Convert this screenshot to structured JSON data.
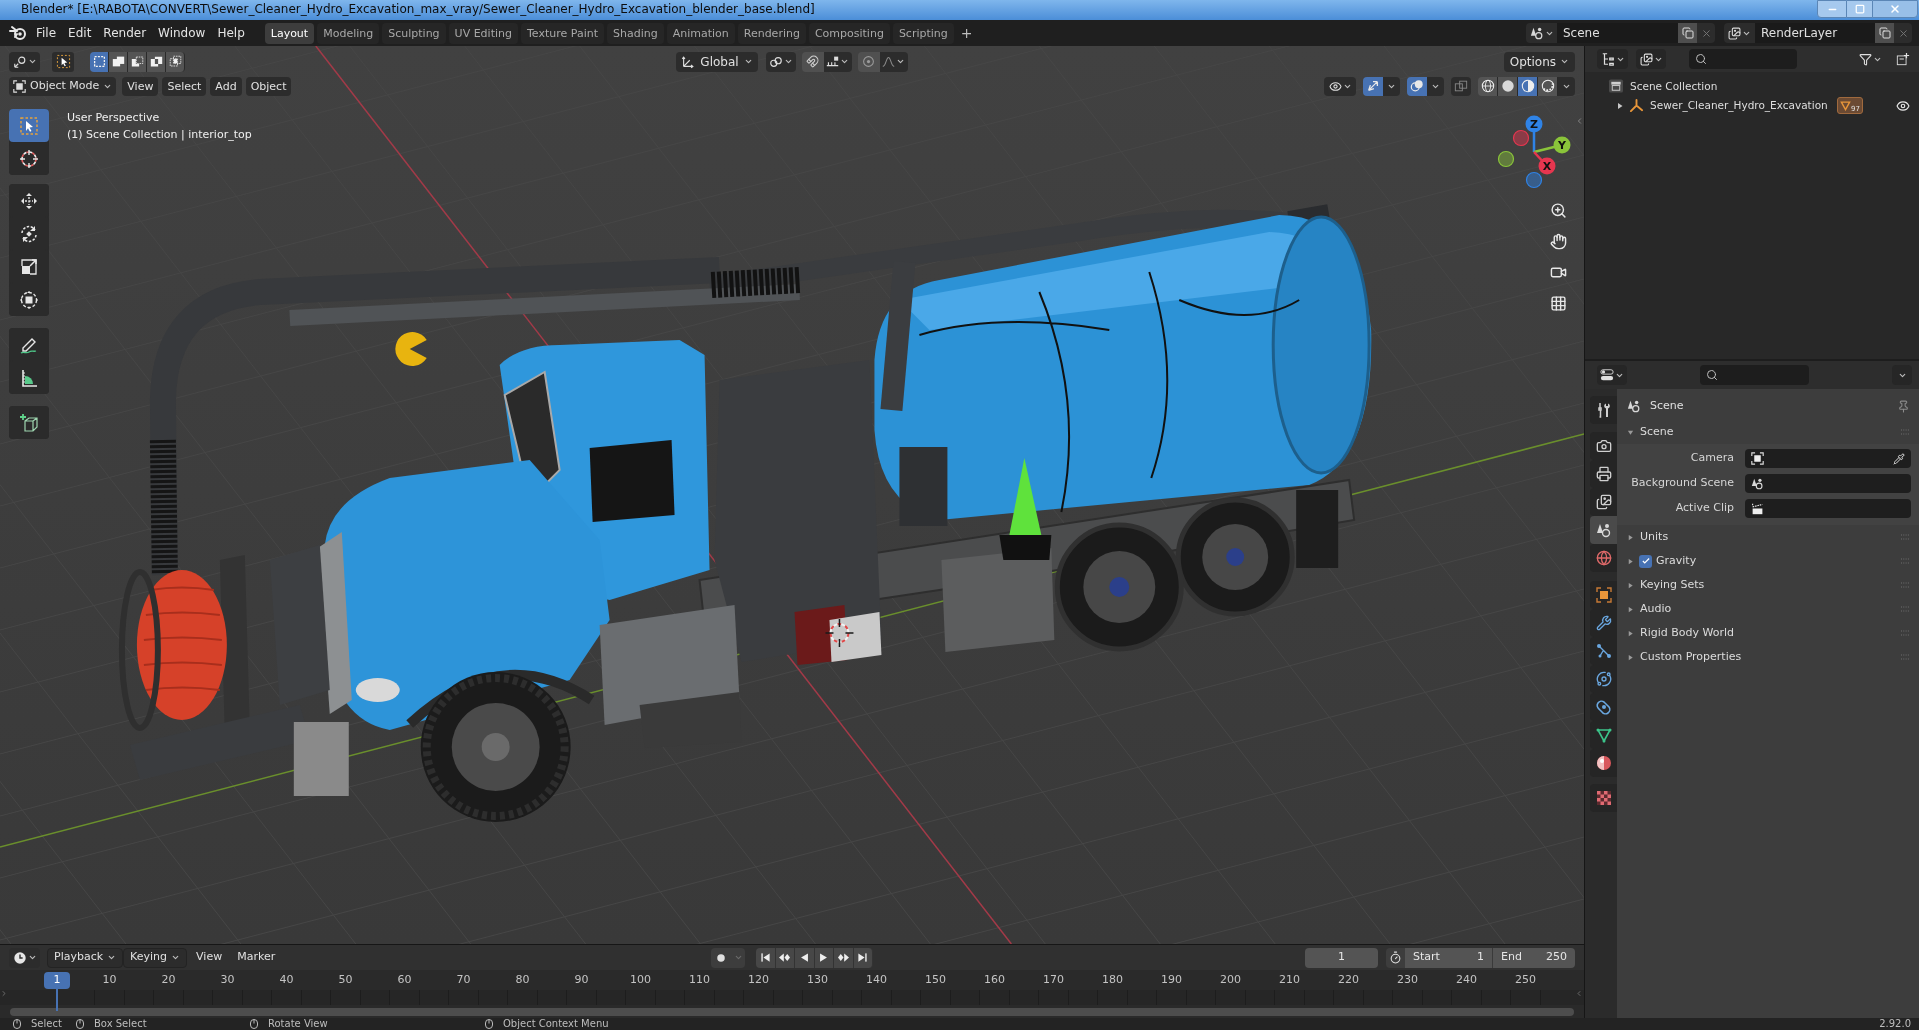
{
  "window": {
    "title": "Blender* [E:\\RABOTA\\CONVERT\\Sewer_Cleaner_Hydro_Excavation_max_vray/Sewer_Cleaner_Hydro_Excavation_blender_base.blend]"
  },
  "top_bar": {
    "menus": [
      "File",
      "Edit",
      "Render",
      "Window",
      "Help"
    ],
    "workspaces": [
      {
        "label": "Layout",
        "selected": true
      },
      {
        "label": "Modeling",
        "selected": false
      },
      {
        "label": "Sculpting",
        "selected": false
      },
      {
        "label": "UV Editing",
        "selected": false
      },
      {
        "label": "Texture Paint",
        "selected": false
      },
      {
        "label": "Shading",
        "selected": false
      },
      {
        "label": "Animation",
        "selected": false
      },
      {
        "label": "Rendering",
        "selected": false
      },
      {
        "label": "Compositing",
        "selected": false
      },
      {
        "label": "Scripting",
        "selected": false
      }
    ],
    "add_workspace": "+",
    "scene": "Scene",
    "view_layer": "RenderLayer"
  },
  "viewport": {
    "tool_header": {
      "selection_modes": [
        {
          "kind": "set",
          "selected": true
        },
        {
          "kind": "extend",
          "selected": false
        },
        {
          "kind": "subtract",
          "selected": false
        },
        {
          "kind": "invert",
          "selected": false
        },
        {
          "kind": "intersect",
          "selected": false
        }
      ],
      "orientation": "Global",
      "toggles": [
        {
          "kind": "snap",
          "on": false
        },
        {
          "kind": "proportional",
          "on": false
        }
      ],
      "options": "Options"
    },
    "header": {
      "mode": "Object Mode",
      "menus": [
        "View",
        "Select",
        "Add",
        "Object"
      ],
      "toggles": [
        {
          "kind": "gizmos",
          "on": true
        },
        {
          "kind": "overlays",
          "on": true
        },
        {
          "kind": "xray",
          "on": false
        }
      ],
      "shading_modes": [
        {
          "kind": "wireframe",
          "selected": false
        },
        {
          "kind": "solid",
          "selected": false
        },
        {
          "kind": "material",
          "selected": true
        },
        {
          "kind": "rendered",
          "selected": false
        }
      ]
    },
    "info": [
      "User Perspective",
      "(1) Scene Collection | interior_top"
    ],
    "tool_groups": [
      {
        "tools": [
          {
            "kind": "select",
            "selected": true
          },
          {
            "kind": "cursor",
            "selected": false
          }
        ]
      },
      {
        "tools": [
          {
            "kind": "move",
            "selected": false
          },
          {
            "kind": "rotate",
            "selected": false
          },
          {
            "kind": "scale",
            "selected": false
          },
          {
            "kind": "transform",
            "selected": false
          }
        ]
      },
      {
        "tools": [
          {
            "kind": "annotate",
            "selected": false
          },
          {
            "kind": "measure",
            "selected": false
          }
        ]
      },
      {
        "tools": [
          {
            "kind": "add_cube",
            "selected": false
          }
        ]
      }
    ],
    "gizmo_axes": [
      {
        "label": "Z",
        "color": "#2f83e6"
      },
      {
        "label": "Y",
        "color": "#8ac43a"
      },
      {
        "label": "X",
        "color": "#e6364f"
      }
    ]
  },
  "outliner": {
    "items": [
      {
        "label": "Scene Collection",
        "kind": "collection",
        "children": [
          {
            "label": "Sewer_Cleaner_Hydro_Excavation",
            "kind": "empty",
            "expanded": false,
            "child_count": "97",
            "visible": true
          }
        ]
      }
    ]
  },
  "properties": {
    "tabs": [
      {
        "kind": "tool",
        "selected": false
      },
      {
        "kind": "render",
        "selected": false
      },
      {
        "kind": "output",
        "selected": false
      },
      {
        "kind": "view_layer",
        "selected": false
      },
      {
        "kind": "scene",
        "selected": true
      },
      {
        "kind": "world",
        "selected": false
      },
      {
        "kind": "object",
        "selected": false
      },
      {
        "kind": "modifiers",
        "selected": false
      },
      {
        "kind": "particles",
        "selected": false
      },
      {
        "kind": "physics",
        "selected": false
      },
      {
        "kind": "constraints",
        "selected": false
      },
      {
        "kind": "data",
        "selected": false
      },
      {
        "kind": "material",
        "selected": false
      },
      {
        "kind": "texture",
        "selected": false
      }
    ],
    "context": "Scene",
    "panels": [
      {
        "title": "Scene",
        "kind": "plain",
        "expanded": true,
        "fields": [
          {
            "label": "Camera",
            "kind": "camera"
          },
          {
            "label": "Background Scene",
            "kind": "scene"
          },
          {
            "label": "Active Clip",
            "kind": "clip"
          }
        ]
      },
      {
        "title": "Units",
        "kind": "plain",
        "expanded": false
      },
      {
        "title": "Gravity",
        "kind": "toggle",
        "expanded": false,
        "checked": true
      },
      {
        "title": "Keying Sets",
        "kind": "plain",
        "expanded": false
      },
      {
        "title": "Audio",
        "kind": "plain",
        "expanded": false
      },
      {
        "title": "Rigid Body World",
        "kind": "plain",
        "expanded": false
      },
      {
        "title": "Custom Properties",
        "kind": "plain",
        "expanded": false
      }
    ]
  },
  "timeline": {
    "menus": [
      {
        "label": "Playback",
        "kind": "dropdown"
      },
      {
        "label": "Keying",
        "kind": "dropdown"
      },
      {
        "label": "View",
        "kind": "menu"
      },
      {
        "label": "Marker",
        "kind": "menu"
      }
    ],
    "auto_keying": {
      "on": false
    },
    "current_frame": "1",
    "start": {
      "label": "Start",
      "value": "1"
    },
    "end": {
      "label": "End",
      "value": "250"
    },
    "playhead": "1",
    "ruler": [
      "10",
      "20",
      "30",
      "40",
      "50",
      "60",
      "70",
      "80",
      "90",
      "100",
      "110",
      "120",
      "130",
      "140",
      "150",
      "160",
      "170",
      "180",
      "190",
      "200",
      "210",
      "220",
      "230",
      "240",
      "250"
    ]
  },
  "status_bar": {
    "hints": [
      "Select",
      "Box Select",
      "Rotate View",
      "Object Context Menu"
    ],
    "version": "2.92.0"
  }
}
